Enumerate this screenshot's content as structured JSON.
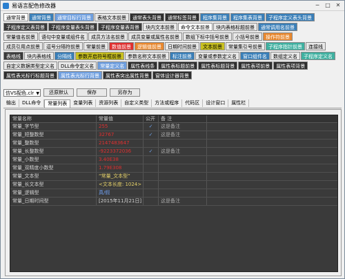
{
  "window": {
    "title": "易语言配色修改器",
    "minimize": "─",
    "maximize": "□",
    "close": "✕"
  },
  "colors": {
    "accent": "#2a7fd0",
    "table_bg": "#3a3a3a",
    "row_label": "#d4d4d4",
    "value_red": "#e03030",
    "value_blue": "#6f9fef",
    "value_yellow": "#e6d26a",
    "check_color": "#6fa0e6"
  },
  "color_buttons": [
    [
      {
        "label": "通常背景",
        "bg": "#ffffff",
        "fg": "#000000"
      },
      {
        "label": "通常背景",
        "bg": "#3a7fb8",
        "fg": "#ffffff"
      },
      {
        "label": "通常目标行背景",
        "bg": "#6f9fdf",
        "fg": "#ffffff"
      },
      {
        "label": "表格文本前景",
        "bg": "#e8e8e8",
        "fg": "#000000"
      },
      {
        "label": "通常表头背景",
        "bg": "#2f2f2f",
        "fg": "#ffffff"
      },
      {
        "label": "通常标签背景",
        "bg": "#2f2f2f",
        "fg": "#ffffff"
      },
      {
        "label": "程序集背景",
        "bg": "#3a7fb8",
        "fg": "#ffffff"
      },
      {
        "label": "程序集表背景",
        "bg": "#3a7fb8",
        "fg": "#ffffff"
      },
      {
        "label": "子程序定义表头背景",
        "bg": "#3a7fb8",
        "fg": "#ffffff"
      }
    ],
    [
      {
        "label": "子程序定义表背景",
        "bg": "#3a3a3a",
        "fg": "#ffffff"
      },
      {
        "label": "子程序变量表头背景",
        "bg": "#3a3a3a",
        "fg": "#ffffff"
      },
      {
        "label": "子程序变量表背景",
        "bg": "#3a3a3a",
        "fg": "#ffffff"
      },
      {
        "label": "块内文本前景",
        "bg": "#e8e8e8",
        "fg": "#000000"
      },
      {
        "label": "命令文本前景",
        "bg": "#ffffff",
        "fg": "#000000"
      },
      {
        "label": "块内表格标题前景",
        "bg": "#e8e8e8",
        "fg": "#000000"
      },
      {
        "label": "通常调用名前景",
        "bg": "#3a7fb8",
        "fg": "#ffffff"
      }
    ],
    [
      {
        "label": "常量值名前景",
        "bg": "#e8e8e8",
        "fg": "#000000"
      },
      {
        "label": "语句中变量或组件名",
        "bg": "#e8e8e8",
        "fg": "#000000"
      },
      {
        "label": "成员方法名前景",
        "bg": "#e8e8e8",
        "fg": "#000000"
      },
      {
        "label": "成员变量或属性名前景",
        "bg": "#e8e8e8",
        "fg": "#000000"
      },
      {
        "label": "数组下标中括号前景",
        "bg": "#e8e8e8",
        "fg": "#000000"
      },
      {
        "label": "小括号前景",
        "bg": "#e8e8e8",
        "fg": "#000000"
      },
      {
        "label": "操作符前景",
        "bg": "#e8882f",
        "fg": "#ffffff"
      }
    ],
    [
      {
        "label": "成员引用点前景",
        "bg": "#e8e8e8",
        "fg": "#000000"
      },
      {
        "label": "逗号分隔符前景",
        "bg": "#e8e8e8",
        "fg": "#000000"
      },
      {
        "label": "常量前景",
        "bg": "#e8e8e8",
        "fg": "#000000"
      },
      {
        "label": "数值前景",
        "bg": "#e03030",
        "fg": "#ffffff"
      },
      {
        "label": "逻辑值前景",
        "bg": "#e8882f",
        "fg": "#ffffff"
      },
      {
        "label": "日期时间前景",
        "bg": "#e8e8e8",
        "fg": "#000000"
      },
      {
        "label": "文本前景",
        "bg": "#c8c020",
        "fg": "#000000"
      },
      {
        "label": "常量集引号前景",
        "bg": "#e8e8e8",
        "fg": "#000000"
      },
      {
        "label": "子程序指针前景",
        "bg": "#3fb0a0",
        "fg": "#ffffff"
      },
      {
        "label": "连接线",
        "bg": "#e8e8e8",
        "fg": "#000000"
      }
    ],
    [
      {
        "label": "表格线",
        "bg": "#3a3a3a",
        "fg": "#ffffff"
      },
      {
        "label": "块内表格线",
        "bg": "#e8e8e8",
        "fg": "#000000"
      },
      {
        "label": "分隔线",
        "bg": "#3a7fb8",
        "fg": "#ffffff"
      },
      {
        "label": "参数开启符号框前景",
        "bg": "#c8c020",
        "fg": "#000000"
      },
      {
        "label": "参数名称文本前景",
        "bg": "#e8e8e8",
        "fg": "#000000"
      },
      {
        "label": "标注前景",
        "bg": "#3a7fb8",
        "fg": "#ffffff"
      },
      {
        "label": "变量或参数定义名",
        "bg": "#e8e8e8",
        "fg": "#000000"
      },
      {
        "label": "窗口组件名",
        "bg": "#3a7fb8",
        "fg": "#ffffff"
      },
      {
        "label": "数组定义名",
        "bg": "#e8e8e8",
        "fg": "#000000"
      },
      {
        "label": "子程序定义名",
        "bg": "#3fb0a0",
        "fg": "#ffffff"
      }
    ],
    [
      {
        "label": "自定义数据类型定义名",
        "bg": "#e8e8e8",
        "fg": "#000000"
      },
      {
        "label": "DLL命令定义名",
        "bg": "#e8e8e8",
        "fg": "#000000"
      },
      {
        "label": "常量定义名",
        "bg": "#6f9fdf",
        "fg": "#ffffff"
      },
      {
        "label": "属性表线条",
        "bg": "#2f2f2f",
        "fg": "#ffffff"
      },
      {
        "label": "属性表标题前景",
        "bg": "#2f2f2f",
        "fg": "#ffffff"
      },
      {
        "label": "属性表标题背景",
        "bg": "#2f2f2f",
        "fg": "#ffffff"
      },
      {
        "label": "属性表项前景",
        "bg": "#2f2f2f",
        "fg": "#ffffff"
      },
      {
        "label": "属性表项背景",
        "bg": "#2f2f2f",
        "fg": "#ffffff"
      }
    ],
    [
      {
        "label": "属性表光标行标题背景",
        "bg": "#2f2f2f",
        "fg": "#ffffff"
      },
      {
        "label": "属性表光标行背景",
        "bg": "#6f9fdf",
        "fg": "#ffffff"
      },
      {
        "label": "属性表突出属性背景",
        "bg": "#2f2f2f",
        "fg": "#ffffff"
      },
      {
        "label": "窗体设计器背景",
        "bg": "#2f2f2f",
        "fg": "#ffffff"
      }
    ]
  ],
  "controls": {
    "preset_value": "仿VS配色.clr",
    "restore_default": "还原默认",
    "save": "保存",
    "save_as": "另存为"
  },
  "tabs": [
    "输出",
    "DLL命令",
    "常量列表",
    "变量列表",
    "资源列表",
    "自定义类型",
    "方法或程序",
    "代码区",
    "设计窗口",
    "属性栏"
  ],
  "active_tab": 2,
  "table": {
    "headers": [
      "常量名称",
      "常量值",
      "公开",
      "备 注"
    ],
    "rows": [
      {
        "name": "常量_字节型",
        "value": "255",
        "value_color": "#e03030",
        "public": "✓",
        "note": "这是备注"
      },
      {
        "name": "常量_短整数型",
        "value": "32767",
        "value_color": "#e03030",
        "public": "✓",
        "note": "这是备注"
      },
      {
        "name": "常量_整数型",
        "value": "2147483647",
        "value_color": "#e03030",
        "public": "",
        "note": ""
      },
      {
        "name": "常量_长整数型",
        "value": "-9223372036",
        "value_color": "#e03030",
        "public": "✓",
        "note": "这是备注"
      },
      {
        "name": "常量_小数型",
        "value": "3.40E38",
        "value_color": "#e03030",
        "public": "",
        "note": ""
      },
      {
        "name": "常量_双精度小数型",
        "value": "1.79E308",
        "value_color": "#e03030",
        "public": "",
        "note": ""
      },
      {
        "name": "常量_文本型",
        "value": "“常量_文本型”",
        "value_color": "#e6d26a",
        "public": "",
        "note": ""
      },
      {
        "name": "常量_长文本型",
        "value": "<文本长度: 1024>",
        "value_color": "#e6d26a",
        "public": "",
        "note": ""
      },
      {
        "name": "常量_逻辑型",
        "value": "真/假",
        "value_color": "#6f9fef",
        "public": "",
        "note": ""
      },
      {
        "name": "常量_日期时间型",
        "value": "[2015年11月21日]",
        "value_color": "#d4d4d4",
        "public": "",
        "note": "这是备注"
      }
    ]
  }
}
